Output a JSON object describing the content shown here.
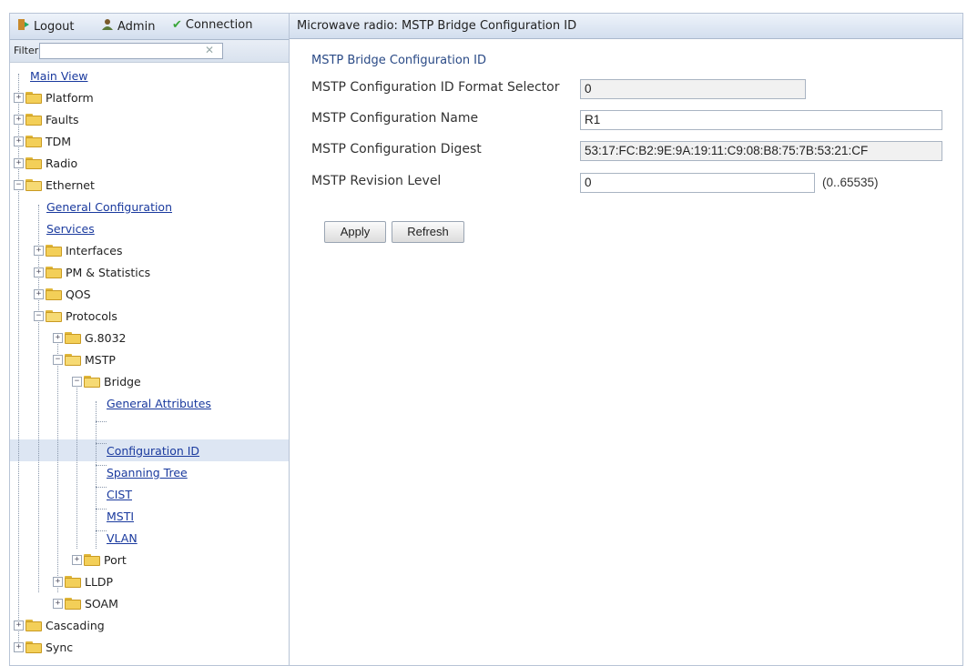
{
  "toolbar": {
    "logout": "Logout",
    "admin": "Admin",
    "connection": "Connection",
    "colors": {
      "logout": "#c8892b",
      "admin": "#7a5a2a",
      "connection": "#3aa63a"
    }
  },
  "filter": {
    "label": "Filter",
    "value": "",
    "clear": "✕"
  },
  "tree": {
    "main_view": "Main View",
    "platform": "Platform",
    "faults": "Faults",
    "tdm": "TDM",
    "radio": "Radio",
    "ethernet": "Ethernet",
    "general_configuration": "General Configuration",
    "services": "Services",
    "interfaces": "Interfaces",
    "pm_statistics": "PM & Statistics",
    "qos": "QOS",
    "protocols": "Protocols",
    "g8032": "G.8032",
    "mstp": "MSTP",
    "bridge": "Bridge",
    "general_attributes": "General Attributes",
    "configuration_id": "Configuration ID",
    "spanning_tree": "Spanning Tree",
    "cist": "CIST",
    "msti": "MSTI",
    "vlan": "VLAN",
    "port": "Port",
    "lldp": "LLDP",
    "soam": "SOAM",
    "cascading": "Cascading",
    "sync": "Sync",
    "selected_item": "Configuration ID"
  },
  "main": {
    "title": "Microwave radio: MSTP Bridge Configuration ID",
    "section_title": "MSTP Bridge Configuration ID",
    "fields": {
      "format_selector_label": "MSTP Configuration ID Format Selector",
      "format_selector_value": "0",
      "name_label": "MSTP Configuration Name",
      "name_value": "R1",
      "digest_label": "MSTP Configuration Digest",
      "digest_value": "53:17:FC:B2:9E:9A:19:11:C9:08:B8:75:7B:53:21:CF",
      "revision_label": "MSTP Revision Level",
      "revision_value": "0",
      "revision_range": "(0..65535)"
    },
    "buttons": {
      "apply": "Apply",
      "refresh": "Refresh"
    }
  }
}
